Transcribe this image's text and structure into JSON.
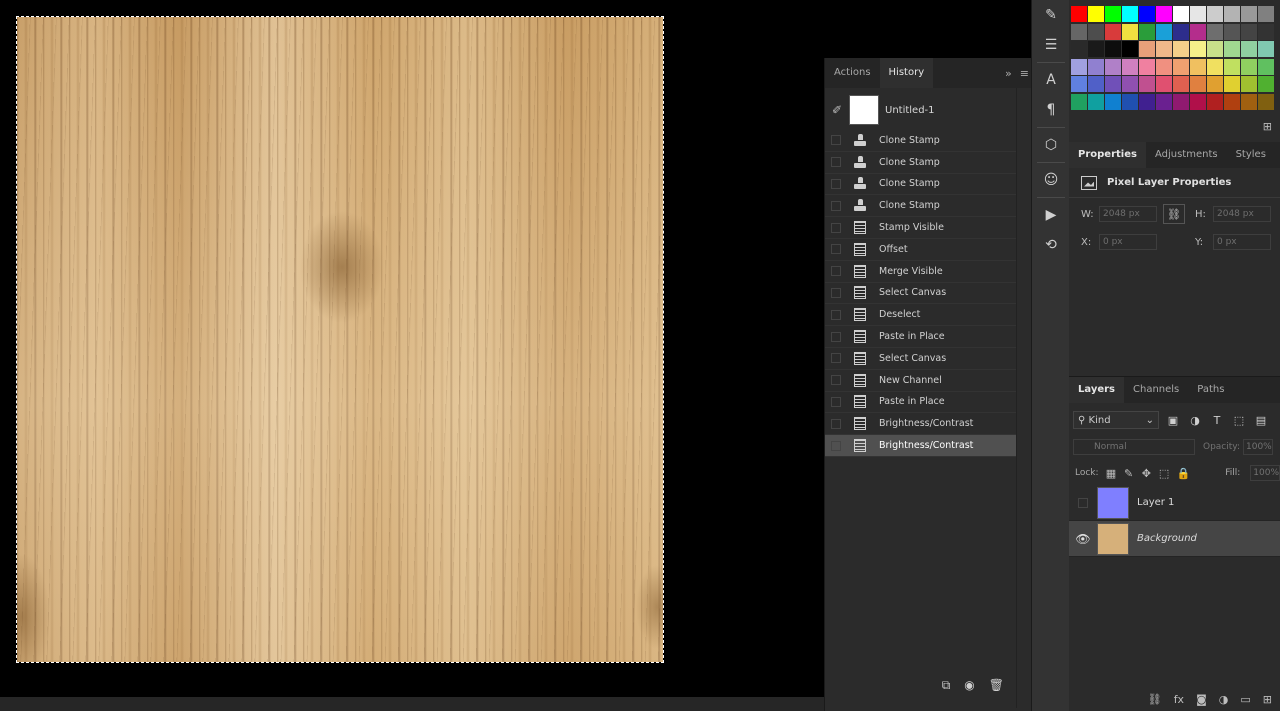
{
  "history": {
    "tabs": [
      {
        "label": "Actions"
      },
      {
        "label": "History"
      }
    ],
    "snapshot": {
      "name": "Untitled-1"
    },
    "items": [
      {
        "label": "Clone Stamp",
        "icon": "clone-stamp-icon"
      },
      {
        "label": "Clone Stamp",
        "icon": "clone-stamp-icon"
      },
      {
        "label": "Clone Stamp",
        "icon": "clone-stamp-icon"
      },
      {
        "label": "Clone Stamp",
        "icon": "clone-stamp-icon"
      },
      {
        "label": "Stamp Visible",
        "icon": "document-icon"
      },
      {
        "label": "Offset",
        "icon": "document-icon"
      },
      {
        "label": "Merge Visible",
        "icon": "document-icon"
      },
      {
        "label": "Select Canvas",
        "icon": "document-icon"
      },
      {
        "label": "Deselect",
        "icon": "document-icon"
      },
      {
        "label": "Paste in Place",
        "icon": "document-icon"
      },
      {
        "label": "Select Canvas",
        "icon": "document-icon"
      },
      {
        "label": "New Channel",
        "icon": "document-icon"
      },
      {
        "label": "Paste in Place",
        "icon": "document-icon"
      },
      {
        "label": "Brightness/Contrast",
        "icon": "document-icon"
      },
      {
        "label": "Brightness/Contrast",
        "icon": "document-icon"
      }
    ],
    "selected_index": 14
  },
  "swatches": {
    "rows": [
      [
        "#ff0000",
        "#ffff00",
        "#00ff00",
        "#00ffff",
        "#0000ff",
        "#ff00ff",
        "#ffffff",
        "#e6e6e6",
        "#cccccc",
        "#b3b3b3",
        "#999999",
        "#808080"
      ],
      [
        "#666666",
        "#4d4d4d",
        "#d83b3b",
        "#f0e040",
        "#2a9d3a",
        "#1aa0d8",
        "#2d2d8c",
        "#b42d8c",
        "#6e6e6e",
        "#555555",
        "#444444",
        "#333333"
      ],
      [
        "#2a2a2a",
        "#1a1a1a",
        "#0d0d0d",
        "#000000",
        "#e8a07a",
        "#f0b88a",
        "#f5d08a",
        "#f5f08a",
        "#c8e08a",
        "#a0d890",
        "#90d0a0",
        "#80c8b0"
      ],
      [
        "#a0a0e0",
        "#9080d0",
        "#b080c8",
        "#d080c0",
        "#f080a0",
        "#f09080",
        "#f0a070",
        "#f0c060",
        "#f0e060",
        "#c0e060",
        "#90d060",
        "#60c060"
      ],
      [
        "#6080e0",
        "#5060c8",
        "#7050b8",
        "#9050b0",
        "#c05090",
        "#e05070",
        "#e06050",
        "#e08040",
        "#e0a030",
        "#e0d030",
        "#a0c030",
        "#50b030"
      ],
      [
        "#20a060",
        "#10a0a0",
        "#1080d0",
        "#2050b0",
        "#402090",
        "#6a2090",
        "#901a70",
        "#b0104a",
        "#b02020",
        "#b04010",
        "#a06010",
        "#806010"
      ]
    ]
  },
  "properties": {
    "tabs": [
      {
        "label": "Properties"
      },
      {
        "label": "Adjustments"
      },
      {
        "label": "Styles"
      }
    ],
    "title": "Pixel Layer Properties",
    "w_label": "W:",
    "w_value": "2048 px",
    "h_label": "H:",
    "h_value": "2048 px",
    "x_label": "X:",
    "x_value": "0 px",
    "y_label": "Y:",
    "y_value": "0 px"
  },
  "layers": {
    "tabs": [
      {
        "label": "Layers"
      },
      {
        "label": "Channels"
      },
      {
        "label": "Paths"
      }
    ],
    "kind_label": "Kind",
    "blend_mode": "Normal",
    "opacity_label": "Opacity:",
    "opacity_value": "100%",
    "lock_label": "Lock:",
    "fill_label": "Fill:",
    "fill_value": "100%",
    "items": [
      {
        "name": "Layer 1",
        "thumb_color": "#7f7fff",
        "visible": false
      },
      {
        "name": "Background",
        "thumb_color": "#d6b07a",
        "visible": true
      }
    ],
    "selected_index": 1
  }
}
